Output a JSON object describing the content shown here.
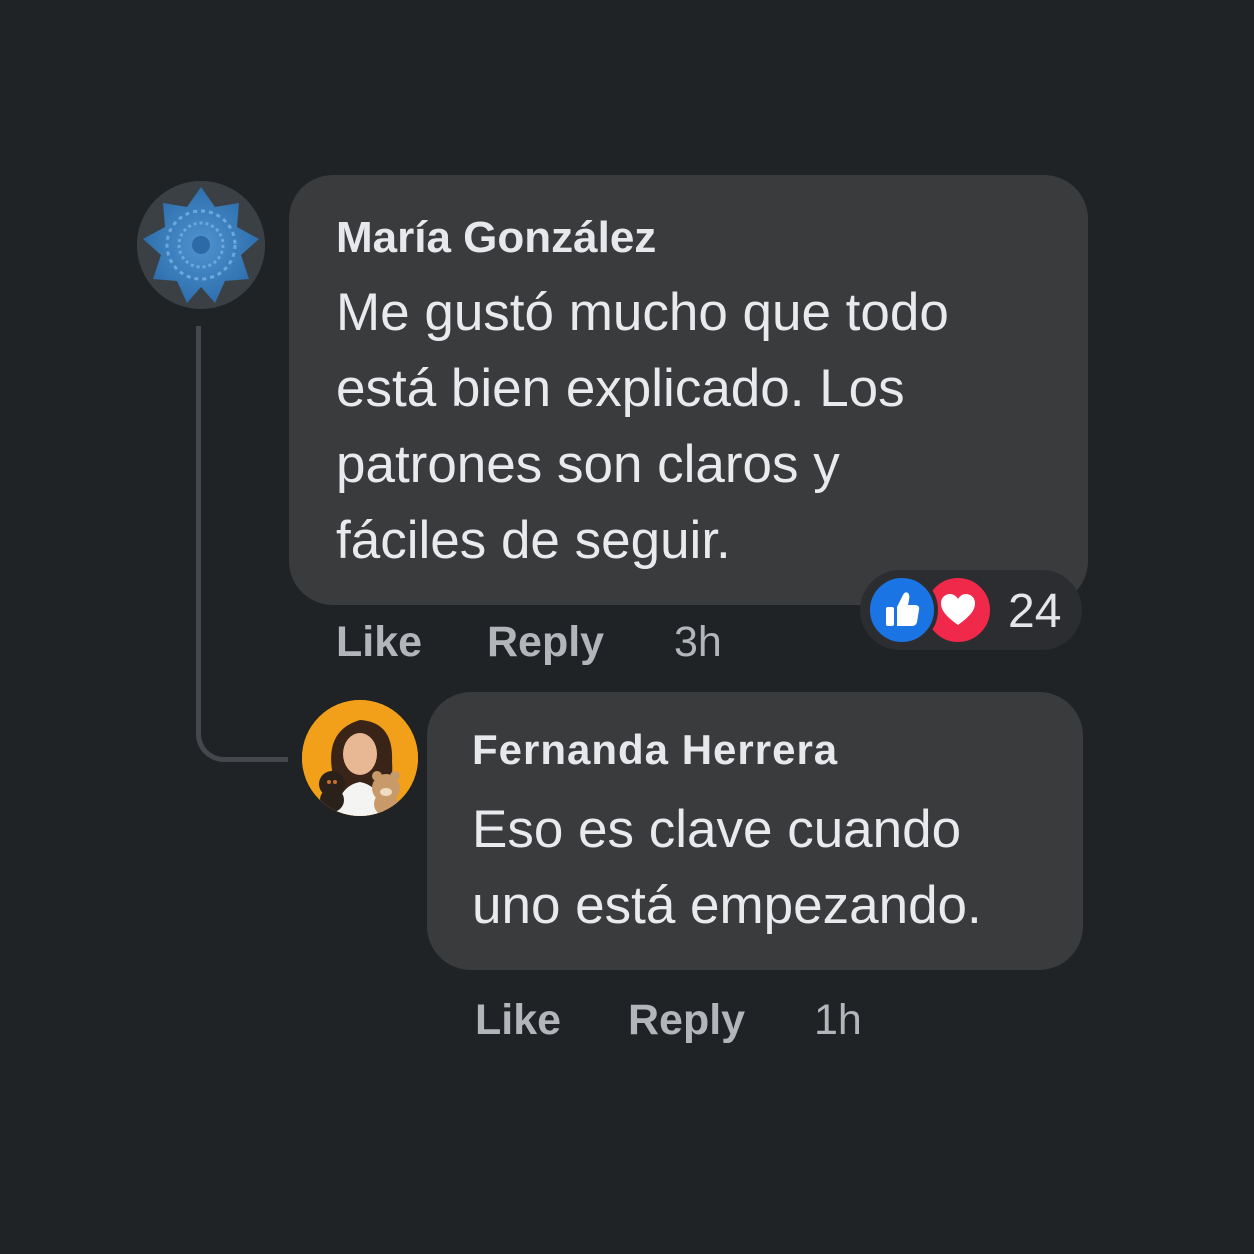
{
  "comments": [
    {
      "author": "María González",
      "text": "Me gustó mucho que todo\nestá bien explicado. Los\npatrones son claros y\nfáciles de seguir.",
      "actions": {
        "like": "Like",
        "reply": "Reply",
        "time": "3h"
      },
      "reactions": {
        "count": "24",
        "icons": [
          "like-icon",
          "love-icon"
        ]
      },
      "avatar_icon": "crochet-doily-avatar"
    },
    {
      "author": "Fernanda Herrera",
      "text": "Eso es clave cuando\nuno está empezando.",
      "actions": {
        "like": "Like",
        "reply": "Reply",
        "time": "1h"
      },
      "avatar_icon": "woman-with-amigurumi-avatar"
    }
  ],
  "colors": {
    "background": "#202326",
    "bubble": "#3a3b3c",
    "like_blue": "#1b74e4",
    "love_red": "#f0284a",
    "avatar_orange": "#f2a019"
  }
}
